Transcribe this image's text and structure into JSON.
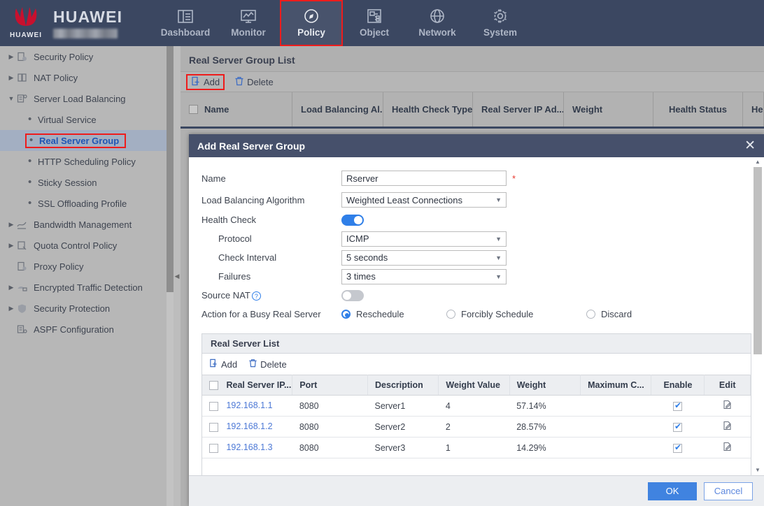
{
  "header": {
    "brand": "HUAWEI",
    "logo_text": "HUAWEI",
    "nav": [
      {
        "label": "Dashboard",
        "icon": "dashboard-icon",
        "active": false
      },
      {
        "label": "Monitor",
        "icon": "monitor-icon",
        "active": false
      },
      {
        "label": "Policy",
        "icon": "compass-icon",
        "active": true
      },
      {
        "label": "Object",
        "icon": "object-icon",
        "active": false
      },
      {
        "label": "Network",
        "icon": "globe-icon",
        "active": false
      },
      {
        "label": "System",
        "icon": "gear-icon",
        "active": false
      }
    ]
  },
  "sidebar": {
    "items": [
      {
        "label": "Security Policy",
        "level": 0,
        "arrow": "collapsed"
      },
      {
        "label": "NAT Policy",
        "level": 0,
        "arrow": "collapsed"
      },
      {
        "label": "Server Load Balancing",
        "level": 0,
        "arrow": "expanded"
      },
      {
        "label": "Virtual Service",
        "level": 1
      },
      {
        "label": "Real Server Group",
        "level": 1,
        "selected": true
      },
      {
        "label": "HTTP Scheduling Policy",
        "level": 1
      },
      {
        "label": "Sticky Session",
        "level": 1
      },
      {
        "label": "SSL Offloading Profile",
        "level": 1
      },
      {
        "label": "Bandwidth Management",
        "level": 0,
        "arrow": "collapsed"
      },
      {
        "label": "Quota Control Policy",
        "level": 0,
        "arrow": "collapsed"
      },
      {
        "label": "Proxy Policy",
        "level": 0,
        "arrow": "none"
      },
      {
        "label": "Encrypted Traffic Detection",
        "level": 0,
        "arrow": "collapsed"
      },
      {
        "label": "Security Protection",
        "level": 0,
        "arrow": "collapsed"
      },
      {
        "label": "ASPF Configuration",
        "level": 0,
        "arrow": "none"
      }
    ]
  },
  "page": {
    "title": "Real Server Group List",
    "toolbar": {
      "add": "Add",
      "delete": "Delete"
    },
    "columns": [
      "Name",
      "Load Balancing Al...",
      "Health Check Type",
      "Real Server IP Ad...",
      "Weight",
      "Health Status",
      "He"
    ]
  },
  "dialog": {
    "title": "Add Real Server Group",
    "close": "✕",
    "fields": {
      "name_label": "Name",
      "name_value": "Rserver",
      "required_mark": "*",
      "algorithm_label": "Load Balancing Algorithm",
      "algorithm_value": "Weighted Least Connections",
      "health_check_label": "Health Check",
      "health_check_on": "on",
      "protocol_label": "Protocol",
      "protocol_value": "ICMP",
      "interval_label": "Check Interval",
      "interval_value": "5 seconds",
      "failures_label": "Failures",
      "failures_value": "3 times",
      "source_nat_label": "Source NAT",
      "source_nat_help": "?",
      "source_nat_on": "off",
      "busy_action_label": "Action for a Busy Real Server",
      "busy_options": [
        {
          "label": "Reschedule",
          "selected": true
        },
        {
          "label": "Forcibly Schedule",
          "selected": false
        },
        {
          "label": "Discard",
          "selected": false
        }
      ]
    },
    "server_list": {
      "title": "Real Server List",
      "toolbar": {
        "add": "Add",
        "delete": "Delete"
      },
      "columns": [
        "Real Server IP...",
        "Port",
        "Description",
        "Weight Value",
        "Weight",
        "Maximum C...",
        "Enable",
        "Edit"
      ],
      "rows": [
        {
          "ip": "192.168.1.1",
          "port": "8080",
          "description": "Server1",
          "weight_value": "4",
          "weight": "57.14%",
          "max_c": "",
          "enable": true,
          "edit": "edit-icon"
        },
        {
          "ip": "192.168.1.2",
          "port": "8080",
          "description": "Server2",
          "weight_value": "2",
          "weight": "28.57%",
          "max_c": "",
          "enable": true,
          "edit": "edit-icon"
        },
        {
          "ip": "192.168.1.3",
          "port": "8080",
          "description": "Server3",
          "weight_value": "1",
          "weight": "14.29%",
          "max_c": "",
          "enable": true,
          "edit": "edit-icon"
        }
      ]
    },
    "footer": {
      "ok": "OK",
      "cancel": "Cancel"
    }
  },
  "colors": {
    "nav_bg": "#3b4761",
    "nav_active": "#48536c",
    "highlight_red": "#ee1c1c",
    "accent_blue": "#2f7fe8",
    "link_blue": "#4d79d6",
    "dialog_head": "#46506b",
    "ok_button": "#4083e0"
  }
}
